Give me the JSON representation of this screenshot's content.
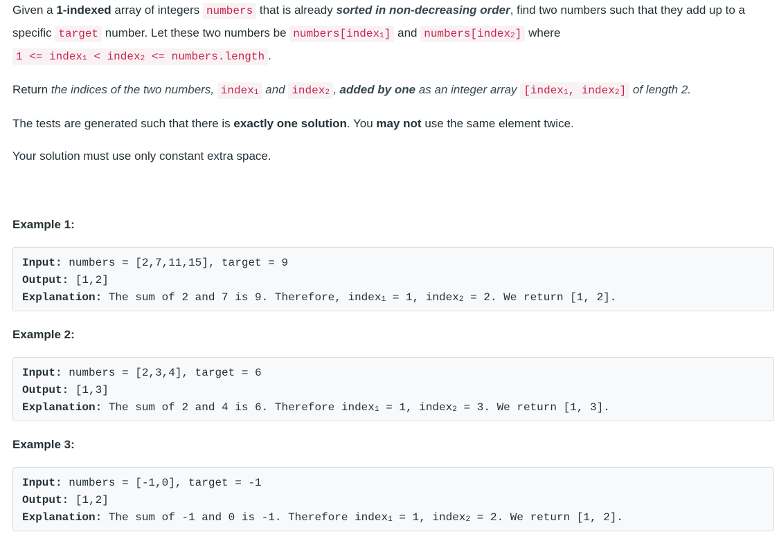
{
  "intro": {
    "t1": "Given a ",
    "b1": "1-indexed",
    "t2": " array of integers ",
    "c_numbers": "numbers",
    "t3": " that is already ",
    "bi1": "sorted in non-decreasing order",
    "t4": ", find two numbers such that they add up to a specific ",
    "c_target": "target",
    "t5": " number. Let these two numbers be ",
    "c_idx1_pre": "numbers[index",
    "sub1": "1",
    "c_idx1_post": "]",
    "t6": " and ",
    "c_idx2_pre": "numbers[index",
    "sub2": "2",
    "c_idx2_post": "]",
    "t7": " where ",
    "c_cond_a": "1 <= index",
    "sub3": "1",
    "c_cond_b": " < index",
    "sub4": "2",
    "c_cond_c": " <= numbers.length",
    "t8": "."
  },
  "return_para": {
    "t1": "Return ",
    "i1": "the indices of the two numbers, ",
    "c1_pre": "index",
    "c1_sub": "1",
    "i2": " and ",
    "c2_pre": "index",
    "c2_sub": "2",
    "i3": ", ",
    "bi1": "added by one",
    "i4": " as an integer array ",
    "c3_a": "[index",
    "c3_sub1": "1",
    "c3_b": ", index",
    "c3_sub2": "2",
    "c3_c": "]",
    "i5": " of length 2."
  },
  "tests_para": {
    "t1": "The tests are generated such that there is ",
    "b1": "exactly one solution",
    "t2": ". You ",
    "b2": "may not",
    "t3": " use the same element twice."
  },
  "space_para": "Your solution must use only constant extra space.",
  "examples": [
    {
      "title": "Example 1:",
      "input_label": "Input:",
      "input_value": " numbers = [2,7,11,15], target = 9",
      "output_label": "Output:",
      "output_value": " [1,2]",
      "expl_label": "Explanation:",
      "expl_a": " The sum of 2 and 7 is 9. Therefore, index",
      "expl_sub1": "1",
      "expl_b": " = 1, index",
      "expl_sub2": "2",
      "expl_c": " = 2. We return [1, 2]."
    },
    {
      "title": "Example 2:",
      "input_label": "Input:",
      "input_value": " numbers = [2,3,4], target = 6",
      "output_label": "Output:",
      "output_value": " [1,3]",
      "expl_label": "Explanation:",
      "expl_a": " The sum of 2 and 4 is 6. Therefore index",
      "expl_sub1": "1",
      "expl_b": " = 1, index",
      "expl_sub2": "2",
      "expl_c": " = 3. We return [1, 3]."
    },
    {
      "title": "Example 3:",
      "input_label": "Input:",
      "input_value": " numbers = [-1,0], target = -1",
      "output_label": "Output:",
      "output_value": " [1,2]",
      "expl_label": "Explanation:",
      "expl_a": " The sum of -1 and 0 is -1. Therefore index",
      "expl_sub1": "1",
      "expl_b": " = 1, index",
      "expl_sub2": "2",
      "expl_c": " = 2. We return [1, 2]."
    }
  ]
}
